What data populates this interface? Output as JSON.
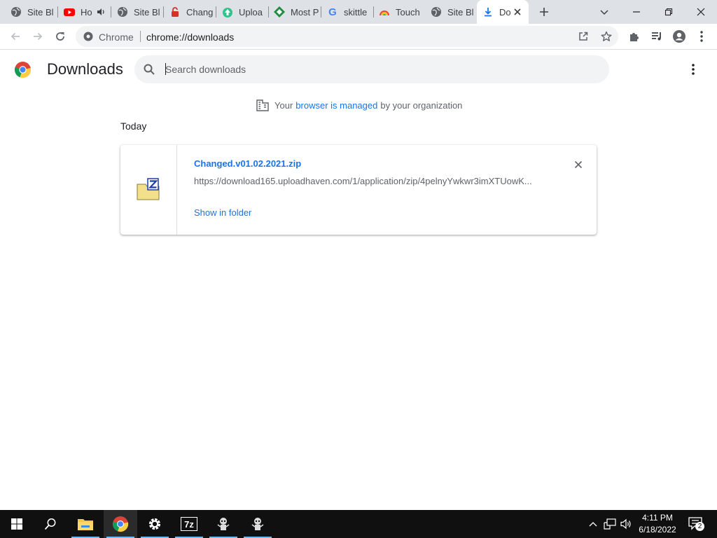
{
  "browser": {
    "tabs": [
      {
        "title": "Site Bl",
        "favicon": "globe-icon"
      },
      {
        "title": "Ho",
        "favicon": "youtube-icon",
        "audio": true
      },
      {
        "title": "Site Bl",
        "favicon": "globe-icon"
      },
      {
        "title": "Chang",
        "favicon": "red-lock-icon"
      },
      {
        "title": "Uploa",
        "favicon": "upload-icon"
      },
      {
        "title": "Most P",
        "favicon": "green-diamond-icon"
      },
      {
        "title": "skittle",
        "favicon": "google-icon"
      },
      {
        "title": "Touch",
        "favicon": "rainbow-icon"
      },
      {
        "title": "Site Bl",
        "favicon": "globe-icon"
      },
      {
        "title": "Do",
        "favicon": "download-icon",
        "active": true
      }
    ],
    "new_tab_label": "+",
    "omnibox": {
      "chip_label": "Chrome",
      "url": "chrome://downloads"
    }
  },
  "downloads_page": {
    "title": "Downloads",
    "search_placeholder": "Search downloads",
    "managed": {
      "prefix": "Your",
      "link": "browser is managed",
      "suffix": "by your organization"
    },
    "section_label": "Today",
    "items": [
      {
        "file_name": "Changed.v01.02.2021.zip",
        "url": "https://download165.uploadhaven.com/1/application/zip/4pelnyYwkwr3imXTUowK...",
        "action_label": "Show in folder"
      }
    ]
  },
  "taskbar": {
    "time": "4:11 PM",
    "date": "6/18/2022",
    "notification_count": "2",
    "apps": [
      "start-icon",
      "search-icon",
      "file-explorer-icon",
      "chrome-icon",
      "settings-icon",
      "7zip-icon",
      "app-icon",
      "app-icon"
    ]
  },
  "colors": {
    "accent": "#1a73e8",
    "tabstrip": "#dee1e6",
    "taskbar": "#101010"
  }
}
